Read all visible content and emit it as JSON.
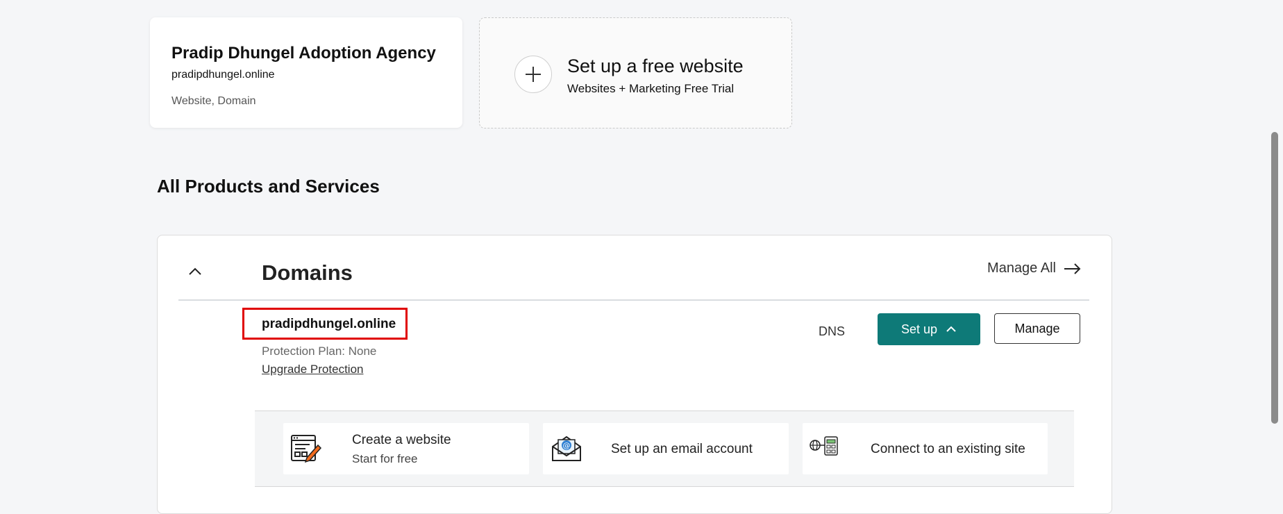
{
  "site_card": {
    "name": "Pradip Dhungel Adoption Agency",
    "domain": "pradipdhungel.online",
    "type": "Website, Domain"
  },
  "new_site_card": {
    "title": "Set up a free website",
    "subtitle": "Websites + Marketing Free Trial"
  },
  "section_title": "All Products and Services",
  "domains_panel": {
    "title": "Domains",
    "manage_all": "Manage All",
    "domain": {
      "name": "pradipdhungel.online",
      "protection": "Protection Plan: None",
      "upgrade": "Upgrade Protection",
      "dns": "DNS",
      "setup": "Set up",
      "manage": "Manage"
    },
    "options": [
      {
        "title": "Create a website",
        "subtitle": "Start for free",
        "icon": "website-builder-icon"
      },
      {
        "title": "Set up an email account",
        "icon": "email-envelope-icon"
      },
      {
        "title": "Connect to an existing site",
        "icon": "globe-connect-icon"
      }
    ]
  },
  "colors": {
    "primary_button": "#0e7a78",
    "highlight_box": "#e00000",
    "background": "#f5f6f8"
  }
}
